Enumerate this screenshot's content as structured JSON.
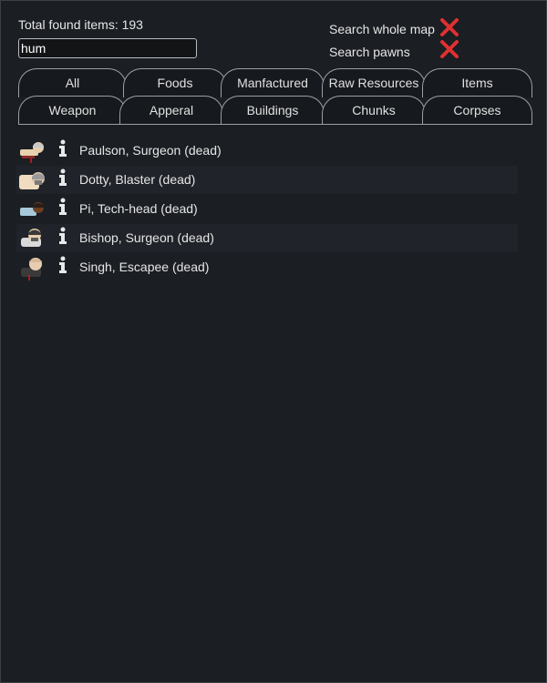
{
  "header": {
    "total_label": "Total found items: 193",
    "search_value": "hum"
  },
  "options": {
    "whole_map_label": "Search whole map",
    "whole_map_state": "off",
    "pawns_label": "Search pawns",
    "pawns_state": "off",
    "off_color": "#e03030"
  },
  "tabs": {
    "row1": [
      "All",
      "Foods",
      "Manfactured",
      "Raw Resources",
      "Items"
    ],
    "row2": [
      "Weapon",
      "Apperal",
      "Buildings",
      "Chunks",
      "Corpses"
    ]
  },
  "results": [
    {
      "label": "Paulson, Surgeon (dead)",
      "icon": "pawn-portrait-icon",
      "info_icon": "info-icon"
    },
    {
      "label": "Dotty, Blaster (dead)",
      "icon": "pawn-portrait-icon",
      "info_icon": "info-icon"
    },
    {
      "label": "Pi, Tech-head (dead)",
      "icon": "pawn-portrait-icon",
      "info_icon": "info-icon"
    },
    {
      "label": "Bishop, Surgeon (dead)",
      "icon": "pawn-portrait-icon",
      "info_icon": "info-icon"
    },
    {
      "label": "Singh, Escapee (dead)",
      "icon": "pawn-portrait-icon",
      "info_icon": "info-icon"
    }
  ]
}
